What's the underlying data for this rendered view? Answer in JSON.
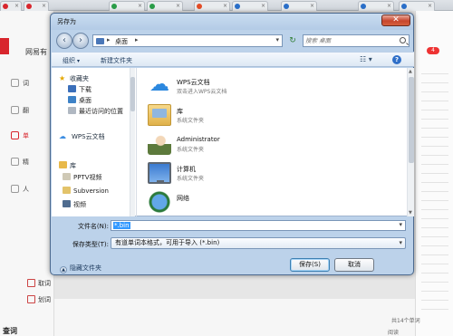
{
  "background": {
    "tabs": [
      {
        "label": "",
        "color": "#d8262d"
      },
      {
        "label": "",
        "color": "#d8262d"
      },
      {
        "label": "",
        "color": "#2a9d48"
      },
      {
        "label": "",
        "color": "#2a9d48"
      },
      {
        "label": "",
        "color": "#e34c26"
      },
      {
        "label": "",
        "color": "#2a6fc9"
      },
      {
        "label": "",
        "color": "#2a6fc9"
      },
      {
        "label": "",
        "color": "#2a6fc9"
      }
    ],
    "left_app_name": "网易有",
    "left_menu": [
      "词",
      "翻",
      "单",
      "精",
      "人"
    ],
    "left_checks": [
      "取词",
      "划词"
    ],
    "right_badge": "4",
    "status_count": "共14个单词",
    "status_read": "阅读",
    "bottom_label": "查词"
  },
  "dialog": {
    "title": "另存为",
    "close_label": "✕",
    "address": {
      "location": "桌面",
      "arrow": "▸"
    },
    "search_placeholder": "搜索 桌面",
    "toolbar": {
      "organize": "组织",
      "new_folder": "新建文件夹"
    },
    "nav": {
      "favorites": "收藏夹",
      "favorites_items": [
        "下载",
        "桌面",
        "最近访问的位置"
      ],
      "wps_cloud": "WPS云文档",
      "library": "库",
      "library_items": [
        "PPTV视频",
        "Subversion",
        "视频"
      ]
    },
    "files": [
      {
        "name": "WPS云文档",
        "desc": "双击进入WPS云文档",
        "icon": "cloud-icon"
      },
      {
        "name": "库",
        "desc": "系统文件夹",
        "icon": "library-icon"
      },
      {
        "name": "Administrator",
        "desc": "系统文件夹",
        "icon": "user-folder-icon"
      },
      {
        "name": "计算机",
        "desc": "系统文件夹",
        "icon": "computer-icon"
      },
      {
        "name": "网络",
        "desc": "",
        "icon": "network-icon"
      }
    ],
    "file_name_label": "文件名(N):",
    "file_name_value": "*.bin",
    "file_type_label": "保存类型(T):",
    "file_type_value": "有道单词本格式，可用于导入 (*.bin)",
    "hide_folders": "隐藏文件夹",
    "save_label": "保存(S)",
    "cancel_label": "取消"
  }
}
